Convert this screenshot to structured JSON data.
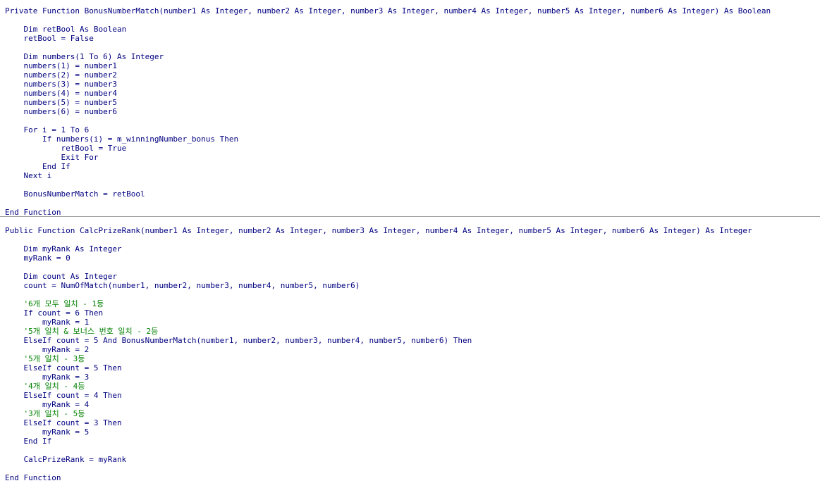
{
  "editor": {
    "procedures": [
      {
        "name": "BonusNumberMatch",
        "lines": [
          {
            "text": "Private Function BonusNumberMatch(number1 As Integer, number2 As Integer, number3 As Integer, number4 As Integer, number5 As Integer, number6 As Integer) As Boolean",
            "kind": "code"
          },
          {
            "text": "",
            "kind": "code"
          },
          {
            "text": "    Dim retBool As Boolean",
            "kind": "code"
          },
          {
            "text": "    retBool = False",
            "kind": "code"
          },
          {
            "text": "",
            "kind": "code"
          },
          {
            "text": "    Dim numbers(1 To 6) As Integer",
            "kind": "code"
          },
          {
            "text": "    numbers(1) = number1",
            "kind": "code"
          },
          {
            "text": "    numbers(2) = number2",
            "kind": "code"
          },
          {
            "text": "    numbers(3) = number3",
            "kind": "code"
          },
          {
            "text": "    numbers(4) = number4",
            "kind": "code"
          },
          {
            "text": "    numbers(5) = number5",
            "kind": "code"
          },
          {
            "text": "    numbers(6) = number6",
            "kind": "code"
          },
          {
            "text": "",
            "kind": "code"
          },
          {
            "text": "    For i = 1 To 6",
            "kind": "code"
          },
          {
            "text": "        If numbers(i) = m_winningNumber_bonus Then",
            "kind": "code"
          },
          {
            "text": "            retBool = True",
            "kind": "code"
          },
          {
            "text": "            Exit For",
            "kind": "code"
          },
          {
            "text": "        End If",
            "kind": "code"
          },
          {
            "text": "    Next i",
            "kind": "code"
          },
          {
            "text": "",
            "kind": "code"
          },
          {
            "text": "    BonusNumberMatch = retBool",
            "kind": "code"
          },
          {
            "text": "",
            "kind": "code"
          },
          {
            "text": "End Function",
            "kind": "code"
          }
        ]
      },
      {
        "name": "CalcPrizeRank",
        "lines": [
          {
            "text": "Public Function CalcPrizeRank(number1 As Integer, number2 As Integer, number3 As Integer, number4 As Integer, number5 As Integer, number6 As Integer) As Integer",
            "kind": "code"
          },
          {
            "text": "",
            "kind": "code"
          },
          {
            "text": "    Dim myRank As Integer",
            "kind": "code"
          },
          {
            "text": "    myRank = 0",
            "kind": "code"
          },
          {
            "text": "",
            "kind": "code"
          },
          {
            "text": "    Dim count As Integer",
            "kind": "code"
          },
          {
            "text": "    count = NumOfMatch(number1, number2, number3, number4, number5, number6)",
            "kind": "code"
          },
          {
            "text": "",
            "kind": "code"
          },
          {
            "text": "    '6개 모두 일치 - 1등",
            "kind": "comment"
          },
          {
            "text": "    If count = 6 Then",
            "kind": "code"
          },
          {
            "text": "        myRank = 1",
            "kind": "code"
          },
          {
            "text": "    '5개 일치 & 보너스 번호 일치 - 2등",
            "kind": "comment"
          },
          {
            "text": "    ElseIf count = 5 And BonusNumberMatch(number1, number2, number3, number4, number5, number6) Then",
            "kind": "code"
          },
          {
            "text": "        myRank = 2",
            "kind": "code"
          },
          {
            "text": "    '5개 일치 - 3등",
            "kind": "comment"
          },
          {
            "text": "    ElseIf count = 5 Then",
            "kind": "code"
          },
          {
            "text": "        myRank = 3",
            "kind": "code"
          },
          {
            "text": "    '4개 일치 - 4등",
            "kind": "comment"
          },
          {
            "text": "    ElseIf count = 4 Then",
            "kind": "code"
          },
          {
            "text": "        myRank = 4",
            "kind": "code"
          },
          {
            "text": "    '3개 일치 - 5등",
            "kind": "comment"
          },
          {
            "text": "    ElseIf count = 3 Then",
            "kind": "code"
          },
          {
            "text": "        myRank = 5",
            "kind": "code"
          },
          {
            "text": "    End If",
            "kind": "code"
          },
          {
            "text": "",
            "kind": "code"
          },
          {
            "text": "    CalcPrizeRank = myRank",
            "kind": "code"
          },
          {
            "text": "",
            "kind": "code"
          },
          {
            "text": "End Function",
            "kind": "code"
          }
        ]
      }
    ],
    "colors": {
      "code_text": "#000080",
      "comment_text": "#008000",
      "background": "#ffffff",
      "separator": "#a0a0a0"
    }
  }
}
